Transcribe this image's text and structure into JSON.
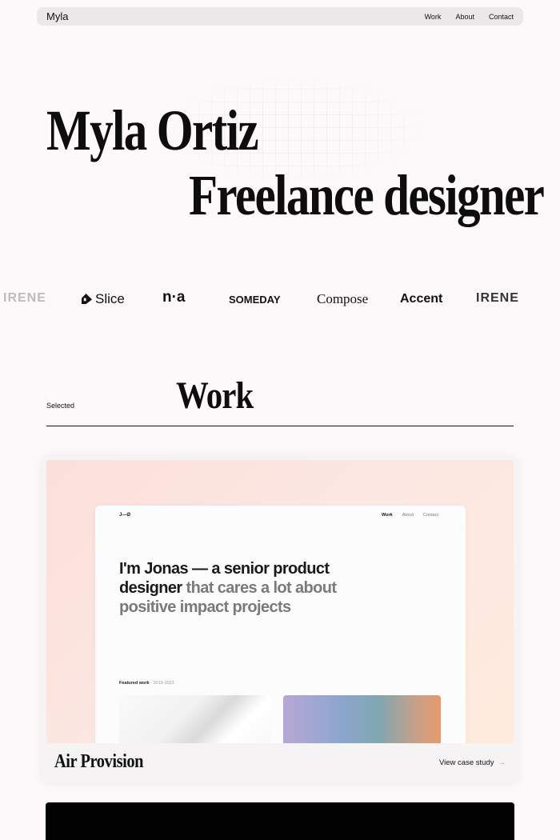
{
  "nav": {
    "brand": "Myla",
    "links": [
      "Work",
      "About",
      "Contact"
    ]
  },
  "hero": {
    "name": "Myla Ortiz",
    "role": "Freelance designer"
  },
  "logos": {
    "irene": "IRENE",
    "slice": "Slice",
    "na": "n·a",
    "someday": "SOMEDAY",
    "compose": "Compose",
    "accent": "Accent"
  },
  "work": {
    "label": "Selected",
    "title": "Work"
  },
  "projects": [
    {
      "title": "Air Provision",
      "link_label": "View case study",
      "preview": {
        "brand": "J—Ø",
        "nav": [
          "Work",
          "About",
          "Contact"
        ],
        "headline_dark": "I'm Jonas — a senior product designer",
        "headline_muted": " that cares a lot about positive impact projects",
        "featured_label": "Featured work",
        "featured_years": "2019-2022"
      }
    }
  ],
  "colors": {
    "background": "#fdf8f9",
    "nav_bg": "#ebe8ea",
    "card_bg": "#f6f3f5",
    "media_gradient_start": "#fbe0d9",
    "media_gradient_end": "#fdecde"
  }
}
